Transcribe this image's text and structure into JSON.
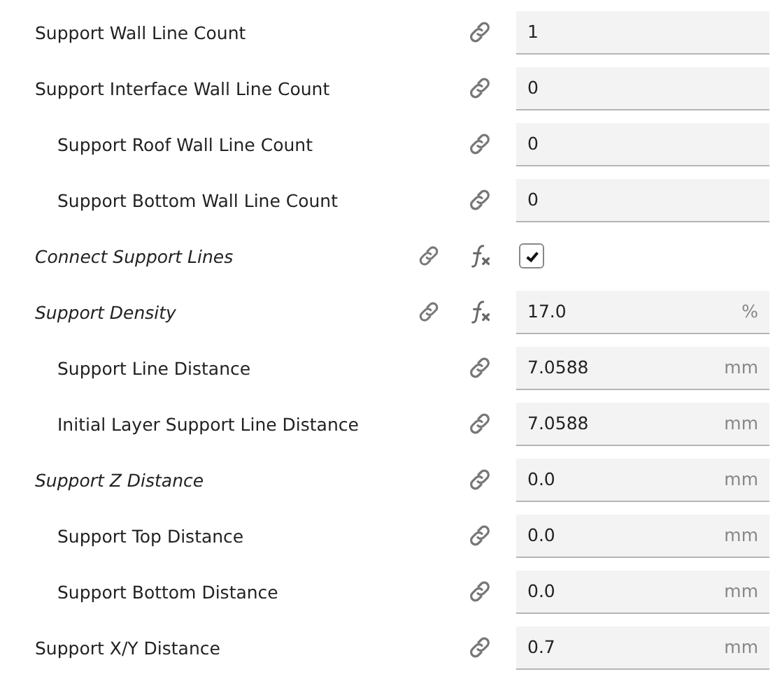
{
  "settings": [
    {
      "label": "Support Wall Line Count",
      "kind": "number",
      "value": "1",
      "modified": false,
      "formula": false
    },
    {
      "label": "Support Interface Wall Line Count",
      "kind": "number",
      "value": "0",
      "modified": false,
      "formula": false,
      "children": [
        {
          "label": "Support Roof Wall Line Count",
          "kind": "number",
          "value": "0",
          "modified": false,
          "formula": false
        },
        {
          "label": "Support Bottom Wall Line Count",
          "kind": "number",
          "value": "0",
          "modified": false,
          "formula": false
        }
      ]
    },
    {
      "label": "Connect Support Lines",
      "kind": "checkbox",
      "checked": true,
      "modified": true,
      "formula": true
    },
    {
      "label": "Support Density",
      "kind": "number",
      "value": "17.0",
      "unit": "%",
      "modified": true,
      "formula": true,
      "children": [
        {
          "label": "Support Line Distance",
          "kind": "number",
          "value": "7.0588",
          "unit": "mm",
          "modified": false,
          "formula": false
        },
        {
          "label": "Initial Layer Support Line Distance",
          "kind": "number",
          "value": "7.0588",
          "unit": "mm",
          "modified": false,
          "formula": false
        }
      ]
    },
    {
      "label": "Support Z Distance",
      "kind": "number",
      "value": "0.0",
      "unit": "mm",
      "modified": true,
      "formula": false,
      "children": [
        {
          "label": "Support Top Distance",
          "kind": "number",
          "value": "0.0",
          "unit": "mm",
          "modified": false,
          "formula": false
        },
        {
          "label": "Support Bottom Distance",
          "kind": "number",
          "value": "0.0",
          "unit": "mm",
          "modified": false,
          "formula": false
        }
      ]
    },
    {
      "label": "Support X/Y Distance",
      "kind": "number",
      "value": "0.7",
      "unit": "mm",
      "modified": false,
      "formula": false
    }
  ]
}
